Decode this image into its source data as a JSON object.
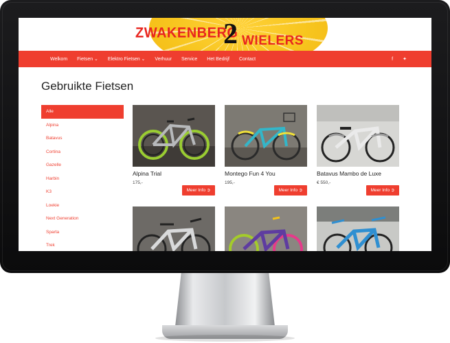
{
  "header": {
    "logo_left": "ZWAKENBERG",
    "logo_number": "2",
    "logo_right": "WIELERS"
  },
  "nav": {
    "items": [
      {
        "label": "Welkom"
      },
      {
        "label": "Fietsen ⌄"
      },
      {
        "label": "Elektro Fietsen ⌄"
      },
      {
        "label": "Verhuur"
      },
      {
        "label": "Service"
      },
      {
        "label": "Het Bedrijf"
      },
      {
        "label": "Contact"
      }
    ],
    "social": [
      {
        "icon": "facebook-icon",
        "glyph": "f"
      },
      {
        "icon": "twitter-icon",
        "glyph": "✦"
      }
    ]
  },
  "page": {
    "title": "Gebruikte Fietsen"
  },
  "filters": [
    {
      "label": "Alle",
      "active": true
    },
    {
      "label": "Alpina"
    },
    {
      "label": "Batavus"
    },
    {
      "label": "Cortina"
    },
    {
      "label": "Gazelle"
    },
    {
      "label": "Harbin"
    },
    {
      "label": "K3"
    },
    {
      "label": "Loekie"
    },
    {
      "label": "Next Generation"
    },
    {
      "label": "Sparta"
    },
    {
      "label": "Trek"
    }
  ],
  "products": [
    {
      "name": "Alpina Trial",
      "price": "175,-",
      "button": "Meer Info ➲"
    },
    {
      "name": "Montego Fun 4 You",
      "price": "195,-",
      "button": "Meer Info ➲"
    },
    {
      "name": "Batavus Mambo de Luxe",
      "price": "€ 550,-",
      "button": "Meer Info ➲"
    },
    {
      "name": "",
      "price": "",
      "button": ""
    },
    {
      "name": "",
      "price": "",
      "button": ""
    },
    {
      "name": "",
      "price": "",
      "button": ""
    }
  ],
  "colors": {
    "accent": "#ef3e2f",
    "logo_yellow": "#f7c51e"
  }
}
